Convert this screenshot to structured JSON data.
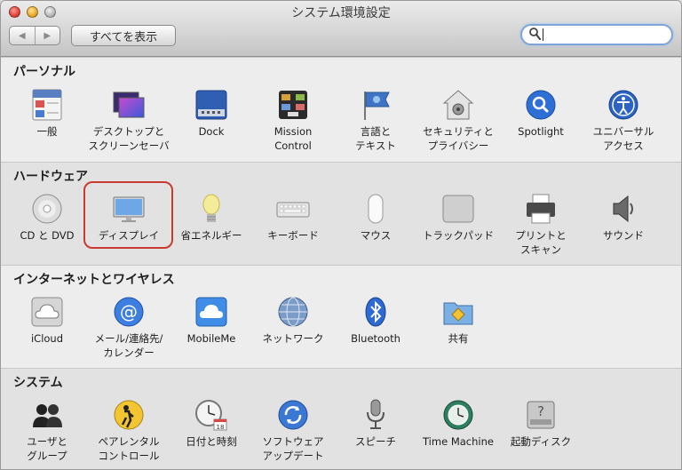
{
  "window": {
    "title": "システム環境設定"
  },
  "toolbar": {
    "back": "◀",
    "forward": "▶",
    "show_all": "すべてを表示",
    "search_value": ""
  },
  "sections": [
    {
      "title": "パーソナル",
      "items": [
        {
          "label": "一般",
          "icon": "general-icon"
        },
        {
          "label": "デスクトップと\nスクリーンセーバ",
          "icon": "desktop-icon"
        },
        {
          "label": "Dock",
          "icon": "dock-icon"
        },
        {
          "label": "Mission\nControl",
          "icon": "mission-control-icon"
        },
        {
          "label": "言語と\nテキスト",
          "icon": "language-icon"
        },
        {
          "label": "セキュリティと\nプライバシー",
          "icon": "security-icon"
        },
        {
          "label": "Spotlight",
          "icon": "spotlight-icon"
        },
        {
          "label": "ユニバーサル\nアクセス",
          "icon": "accessibility-icon"
        }
      ]
    },
    {
      "title": "ハードウェア",
      "items": [
        {
          "label": "CD と DVD",
          "icon": "cd-icon"
        },
        {
          "label": "ディスプレイ",
          "icon": "display-icon"
        },
        {
          "label": "省エネルギー",
          "icon": "energy-icon"
        },
        {
          "label": "キーボード",
          "icon": "keyboard-icon"
        },
        {
          "label": "マウス",
          "icon": "mouse-icon"
        },
        {
          "label": "トラックパッド",
          "icon": "trackpad-icon"
        },
        {
          "label": "プリントと\nスキャン",
          "icon": "printer-icon"
        },
        {
          "label": "サウンド",
          "icon": "sound-icon"
        }
      ]
    },
    {
      "title": "インターネットとワイヤレス",
      "items": [
        {
          "label": "iCloud",
          "icon": "icloud-icon"
        },
        {
          "label": "メール/連絡先/\nカレンダー",
          "icon": "mail-icon"
        },
        {
          "label": "MobileMe",
          "icon": "mobileme-icon"
        },
        {
          "label": "ネットワーク",
          "icon": "network-icon"
        },
        {
          "label": "Bluetooth",
          "icon": "bluetooth-icon"
        },
        {
          "label": "共有",
          "icon": "sharing-icon"
        }
      ]
    },
    {
      "title": "システム",
      "items": [
        {
          "label": "ユーザと\nグループ",
          "icon": "users-icon"
        },
        {
          "label": "ペアレンタル\nコントロール",
          "icon": "parental-icon"
        },
        {
          "label": "日付と時刻",
          "icon": "datetime-icon"
        },
        {
          "label": "ソフトウェア\nアップデート",
          "icon": "update-icon"
        },
        {
          "label": "スピーチ",
          "icon": "speech-icon"
        },
        {
          "label": "Time Machine",
          "icon": "timemachine-icon"
        },
        {
          "label": "起動ディスク",
          "icon": "startup-disk-icon"
        }
      ]
    }
  ],
  "colors": {
    "highlight": "#c93a30",
    "search_focus": "#7ea4d8"
  }
}
